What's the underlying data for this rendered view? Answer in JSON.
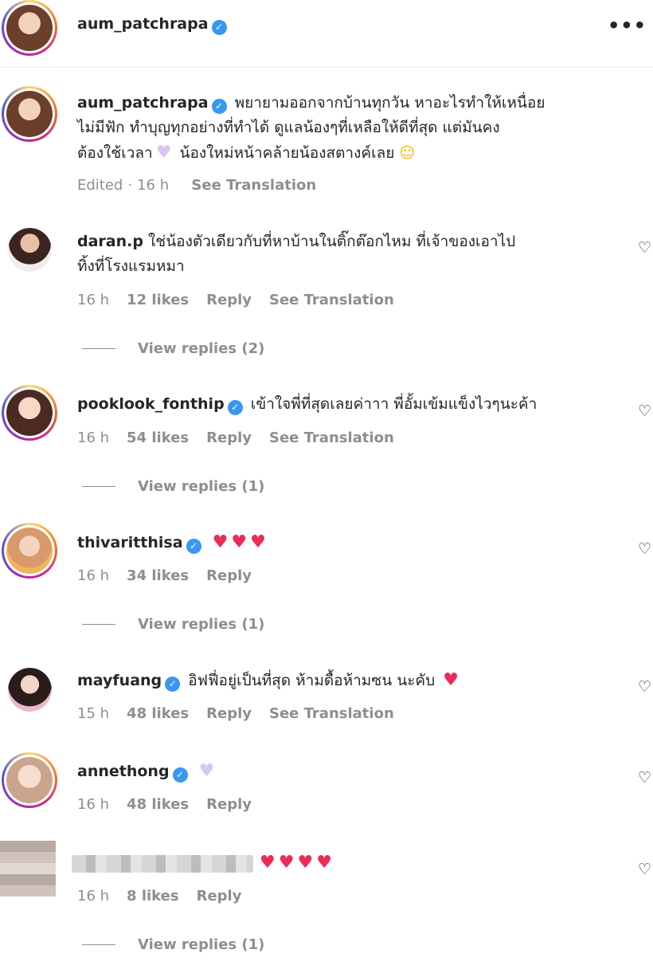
{
  "header": {
    "username": "aum_patchrapa",
    "more_icon": "more-horizontal-icon"
  },
  "caption": {
    "username": "aum_patchrapa",
    "line1": "พยายามออกจากบ้านทุกวัน หาอะไรทำให้เหนื่อย",
    "line2": "ไม่มีฟัก ทำบุญทุกอย่างที่ทำได้ ดูแลน้องๆที่เหลือให้ดีที่สุด แต่มันคง",
    "line3a": "ต้องใช้เวลา",
    "line3b": "น้องใหม่หน้าคล้ายน้องสตางค์เลย",
    "edited": "Edited",
    "time": "16 h",
    "see_translation": "See Translation"
  },
  "comments": [
    {
      "username": "daran.p",
      "text1": "ใช่น้องตัวเดียวกับที่หาบ้านในติ๊กต๊อกไหม ที่เจ้าของเอาไป",
      "text2": "ทิ้งที่โรงแรมหมา",
      "time": "16 h",
      "likes": "12 likes",
      "reply": "Reply",
      "see_translation": "See Translation",
      "view_replies": "View replies (2)"
    },
    {
      "username": "pooklook_fonthip",
      "text1": "เข้าใจพี่ที่สุดเลยค่าาา พี่อั้มเข้มแข็งไวๆนะค้า",
      "time": "16 h",
      "likes": "54 likes",
      "reply": "Reply",
      "see_translation": "See Translation",
      "view_replies": "View replies (1)"
    },
    {
      "username": "thivaritthisa",
      "time": "16 h",
      "likes": "34 likes",
      "reply": "Reply",
      "view_replies": "View replies (1)"
    },
    {
      "username": "mayfuang",
      "text1": "อิฟฟี่อยู่เป็นที่สุด ห้ามดื้อห้ามซน นะคับ",
      "time": "15 h",
      "likes": "48 likes",
      "reply": "Reply",
      "see_translation": "See Translation"
    },
    {
      "username": "annethong",
      "time": "16 h",
      "likes": "48 likes",
      "reply": "Reply"
    },
    {
      "time": "16 h",
      "likes": "8 likes",
      "reply": "Reply",
      "view_replies": "View replies (1)"
    }
  ],
  "colors": {
    "verified": "#3897f0",
    "heart_emoji": "#ed2a5a",
    "lavender_heart": "#d9c7f2",
    "meta_gray": "#8e8e8e"
  }
}
